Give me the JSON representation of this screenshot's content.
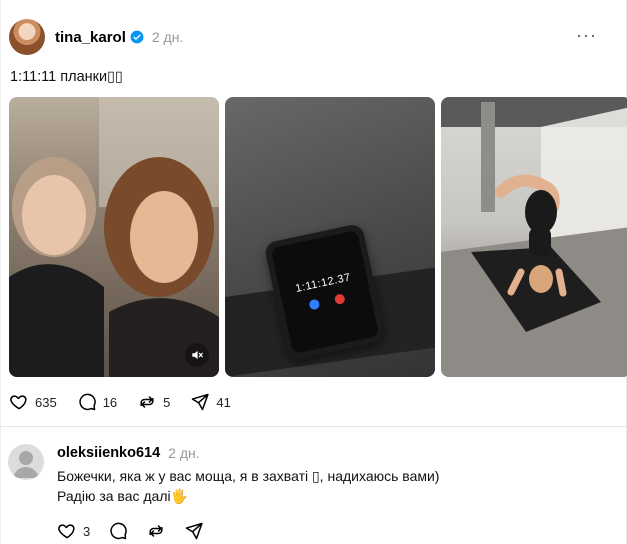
{
  "post": {
    "username": "tina_karol",
    "time": "2 дн.",
    "more_icon": "···",
    "caption": "1:11:11 планки▯▯",
    "media": [
      {
        "type": "video",
        "description": "two women selfie"
      },
      {
        "type": "image",
        "timer": "1:11:12.37"
      },
      {
        "type": "image"
      }
    ],
    "stats": {
      "likes": "635",
      "replies": "16",
      "reposts": "5",
      "shares": "41"
    }
  },
  "comment": {
    "username": "oleksiienko614",
    "time": "2 дн.",
    "line1": "Божечки, яка ж у вас моща, я в захваті ▯, надихаюсь вами)",
    "line2": "Радію за вас далі🖐",
    "likes": "3"
  },
  "colors": {
    "verified": "#0095f6",
    "timer_blue": "#2f80ff",
    "timer_red": "#e23a35"
  },
  "icons": [
    "heart-icon",
    "comment-icon",
    "repost-icon",
    "share-icon",
    "verified-icon",
    "mute-icon",
    "more-icon"
  ]
}
